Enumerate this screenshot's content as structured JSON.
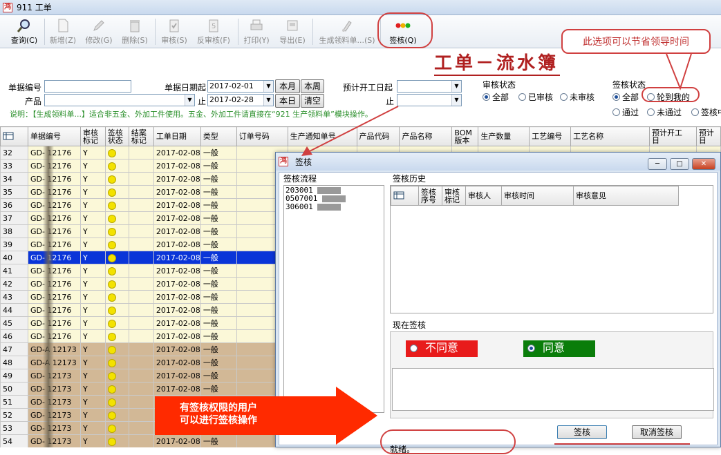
{
  "window": {
    "title": "911 工单",
    "icon": "app-logo-icon"
  },
  "toolbar": [
    {
      "label": "查询(C)",
      "icon": "search-magnifier-icon",
      "enabled": true
    },
    {
      "label": "新增(Z)",
      "icon": "new-document-icon",
      "enabled": false
    },
    {
      "label": "修改(G)",
      "icon": "edit-pencil-icon",
      "enabled": false
    },
    {
      "label": "删除(S)",
      "icon": "trash-icon",
      "enabled": false
    },
    {
      "label": "审核(S)",
      "icon": "approve-clipboard-icon",
      "enabled": false
    },
    {
      "label": "反审核(F)",
      "icon": "unapprove-clipboard-icon",
      "enabled": false
    },
    {
      "label": "打印(Y)",
      "icon": "printer-icon",
      "enabled": false
    },
    {
      "label": "导出(E)",
      "icon": "export-icon",
      "enabled": false
    },
    {
      "label": "生成领料单...(S)",
      "icon": "generate-material-icon",
      "enabled": false
    },
    {
      "label": "签核(Q)",
      "icon": "traffic-light-icon",
      "enabled": true
    }
  ],
  "note": "此选项可以节省领导时间",
  "app_title": "工单－流水簿",
  "filters": {
    "doc_no_label": "单据编号",
    "product_label": "产品",
    "date_from_label": "单据日期起",
    "date_from": "2017-02-01",
    "date_to_label": "止",
    "date_to": "2017-02-28",
    "btn_month": "本月",
    "btn_week": "本周",
    "btn_day": "本日",
    "btn_clear": "清空",
    "plan_start_label": "预计开工日起",
    "plan_end_label": "止",
    "audit_status_label": "审核状态",
    "audit_options": [
      "全部",
      "已审核",
      "未审核"
    ],
    "sign_status_label": "签核状态",
    "sign_options_row1": [
      "全部",
      "轮到我的"
    ],
    "sign_options_row2": [
      "通过",
      "未通过",
      "签核中"
    ]
  },
  "hint": "说明：【生成领料单...】适合非五金、外加工件使用。五金、外加工件请直接在“921 生产领料单”模块操作。",
  "grid": {
    "headers": [
      "单据编号",
      "审核\n标记",
      "签核\n状态",
      "结案\n标记",
      "工单日期",
      "类型",
      "订单号码",
      "生产通知单号",
      "产品代码",
      "产品名称",
      "BOM\n版本",
      "生产数量",
      "工艺编号",
      "工艺名称",
      "预计开工\n日",
      "预计\n日"
    ],
    "rows": [
      {
        "n": "32",
        "doc": "GD-  12176",
        "audit": "Y",
        "date": "2017-02-08",
        "type": "一般",
        "style": "y"
      },
      {
        "n": "33",
        "doc": "GD-  12176",
        "audit": "Y",
        "date": "2017-02-08",
        "type": "一般",
        "style": "y"
      },
      {
        "n": "34",
        "doc": "GD-  12176",
        "audit": "Y",
        "date": "2017-02-08",
        "type": "一般",
        "style": "y"
      },
      {
        "n": "35",
        "doc": "GD-  12176",
        "audit": "Y",
        "date": "2017-02-08",
        "type": "一般",
        "style": "y"
      },
      {
        "n": "36",
        "doc": "GD-  12176",
        "audit": "Y",
        "date": "2017-02-08",
        "type": "一般",
        "style": "y"
      },
      {
        "n": "37",
        "doc": "GD-  12176",
        "audit": "Y",
        "date": "2017-02-08",
        "type": "一般",
        "style": "y"
      },
      {
        "n": "38",
        "doc": "GD-  12176",
        "audit": "Y",
        "date": "2017-02-08",
        "type": "一般",
        "style": "y"
      },
      {
        "n": "39",
        "doc": "GD-  12176",
        "audit": "Y",
        "date": "2017-02-08",
        "type": "一般",
        "style": "y"
      },
      {
        "n": "40",
        "doc": "GD-  12176",
        "audit": "Y",
        "date": "2017-02-08",
        "type": "一般",
        "style": "sel"
      },
      {
        "n": "41",
        "doc": "GD-  12176",
        "audit": "Y",
        "date": "2017-02-08",
        "type": "一般",
        "style": "y"
      },
      {
        "n": "42",
        "doc": "GD-  12176",
        "audit": "Y",
        "date": "2017-02-08",
        "type": "一般",
        "style": "y"
      },
      {
        "n": "43",
        "doc": "GD-  12176",
        "audit": "Y",
        "date": "2017-02-08",
        "type": "一般",
        "style": "y"
      },
      {
        "n": "44",
        "doc": "GD-  12176",
        "audit": "Y",
        "date": "2017-02-08",
        "type": "一般",
        "style": "y"
      },
      {
        "n": "45",
        "doc": "GD-  12176",
        "audit": "Y",
        "date": "2017-02-08",
        "type": "一般",
        "style": "y"
      },
      {
        "n": "46",
        "doc": "GD-  12176",
        "audit": "Y",
        "date": "2017-02-08",
        "type": "一般",
        "style": "y"
      },
      {
        "n": "47",
        "doc": "GD-A 12173",
        "audit": "Y",
        "date": "2017-02-08",
        "type": "一般",
        "style": "b"
      },
      {
        "n": "48",
        "doc": "GD-A 12173",
        "audit": "Y",
        "date": "2017-02-08",
        "type": "一般",
        "style": "b"
      },
      {
        "n": "49",
        "doc": "GD-  12173",
        "audit": "Y",
        "date": "2017-02-08",
        "type": "一般",
        "style": "b"
      },
      {
        "n": "50",
        "doc": "GD-  12173",
        "audit": "Y",
        "date": "2017-02-08",
        "type": "一般",
        "style": "b"
      },
      {
        "n": "51",
        "doc": "GD-  12173",
        "audit": "Y",
        "date": "2017-02-08",
        "type": "一般",
        "style": "b"
      },
      {
        "n": "52",
        "doc": "GD-  12173",
        "audit": "Y",
        "date": "2017-02-08",
        "type": "一般",
        "style": "b"
      },
      {
        "n": "53",
        "doc": "GD-  12173",
        "audit": "Y",
        "date": "2017-02-08",
        "type": "一般",
        "style": "b"
      },
      {
        "n": "54",
        "doc": "GD-  12173",
        "audit": "Y",
        "date": "2017-02-08",
        "type": "一般",
        "style": "b"
      }
    ]
  },
  "dialog": {
    "title": "签核",
    "flow_label": "签核流程",
    "flow_items": [
      "203001",
      "0507001",
      "306001"
    ],
    "history_label": "签核历史",
    "history_headers": [
      "签核\n序号",
      "审核\n标记",
      "审核人",
      "审核时间",
      "审核意见"
    ],
    "current_label": "现在签核",
    "disagree": "不同意",
    "agree": "同意",
    "sign_button": "签核",
    "cancel_sign_button": "取消签核",
    "status": "就绪。"
  },
  "annotation_arrow": "有签核权限的用户\n可以进行签核操作",
  "colors": {
    "accent_red": "#d04040",
    "row_yellow": "#fbf8d8",
    "row_brown": "#d2b896",
    "selection": "#0a35d8",
    "agree_green": "#0a7d0a",
    "disagree_red": "#e81b1b"
  }
}
